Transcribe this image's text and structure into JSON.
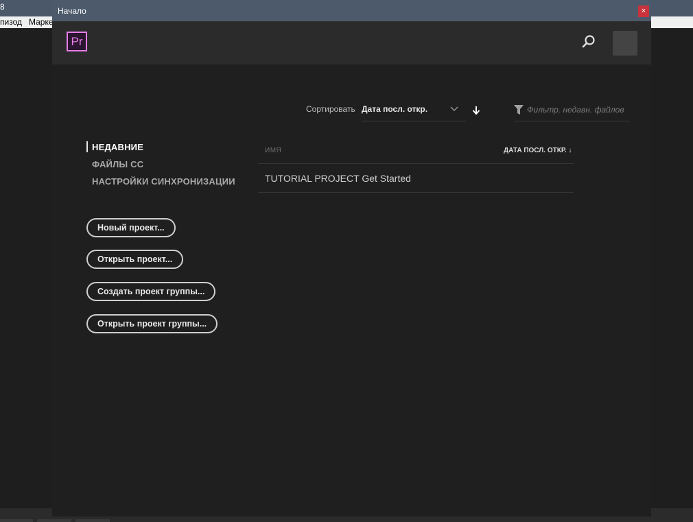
{
  "background": {
    "title_fragment": "8",
    "menu": [
      "пизод",
      "Марке"
    ]
  },
  "dialog": {
    "title": "Начало",
    "close_label": "×",
    "logo_text": "Pr",
    "sort": {
      "label": "Сортировать",
      "value": "Дата посл. откр."
    },
    "filter": {
      "placeholder": "Фильтр. недавн. файлов",
      "value": ""
    },
    "nav": [
      {
        "label": "НЕДАВНИЕ",
        "active": true
      },
      {
        "label": "ФАЙЛЫ CC",
        "active": false
      },
      {
        "label": "НАСТРОЙКИ СИНХРОНИЗАЦИИ",
        "active": false
      }
    ],
    "buttons": [
      {
        "label": "Новый проект..."
      },
      {
        "label": "Открыть проект..."
      },
      {
        "label": "Создать проект группы..."
      },
      {
        "label": "Открыть проект группы..."
      }
    ],
    "table": {
      "col_name": "ИМЯ",
      "col_date": "ДАТА ПОСЛ. ОТКР. ↓",
      "rows": [
        {
          "name": "TUTORIAL PROJECT Get Started"
        }
      ]
    }
  },
  "colors": {
    "accent_logo": "#e77ee9",
    "close_button": "#c9333d",
    "titlebar": "#4c5a6b"
  },
  "icons": [
    "search-icon",
    "chevron-down-icon",
    "arrow-down-icon",
    "filter-icon",
    "close-icon"
  ]
}
